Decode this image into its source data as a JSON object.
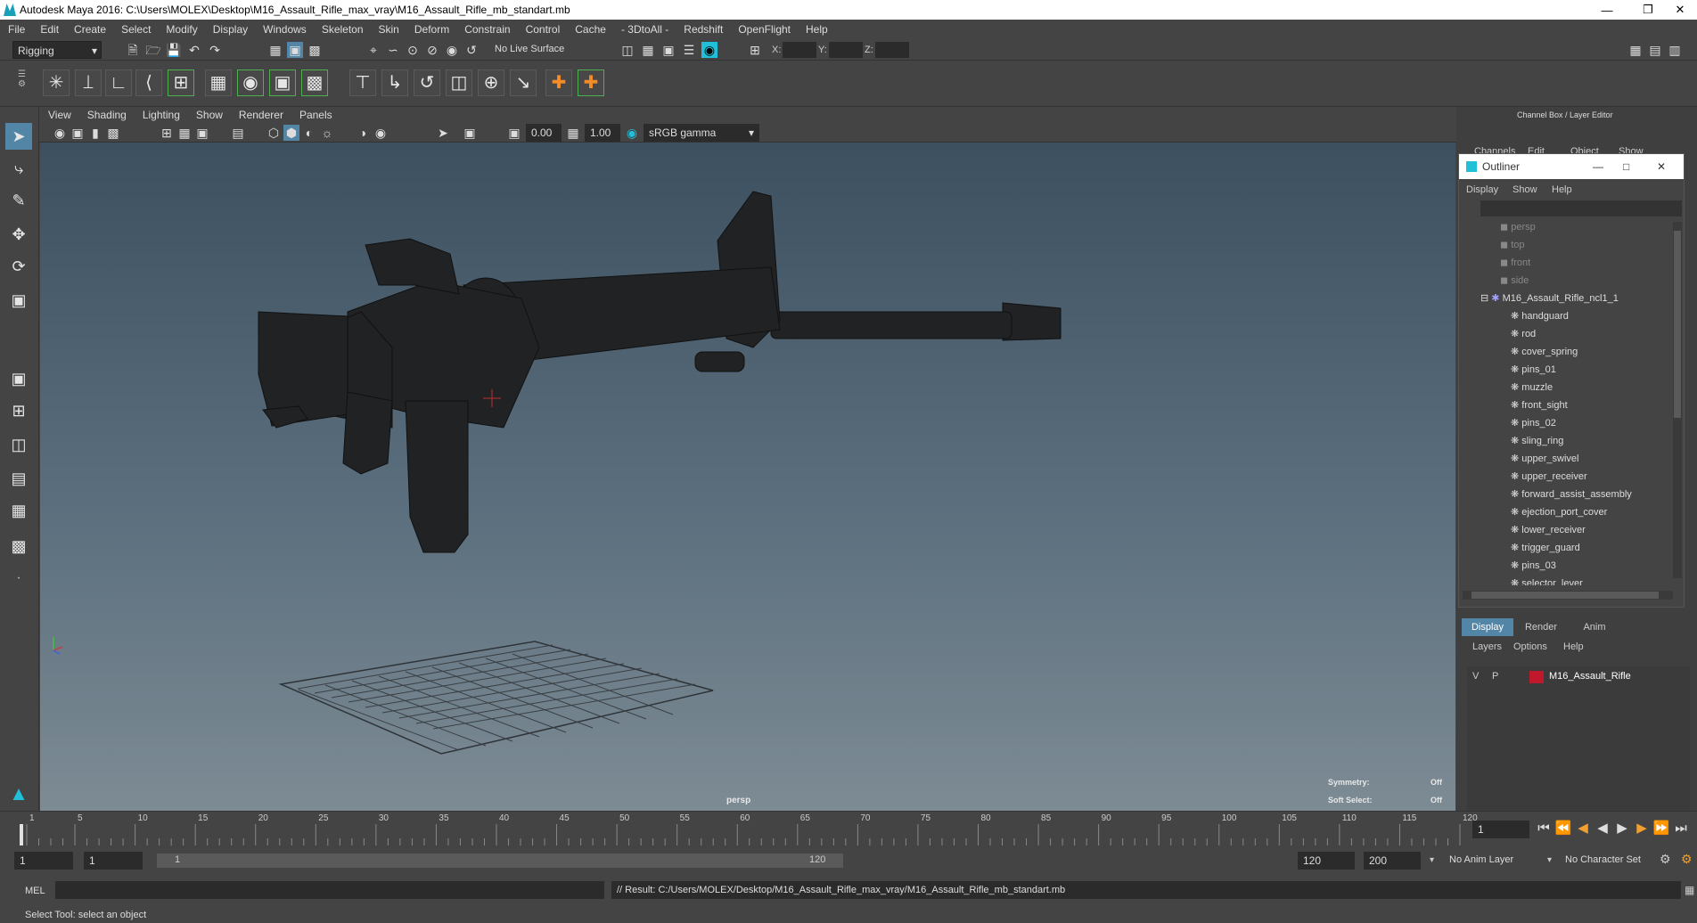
{
  "title": "Autodesk Maya 2016: C:\\Users\\MOLEX\\Desktop\\M16_Assault_Rifle_max_vray\\M16_Assault_Rifle_mb_standart.mb",
  "menu": [
    "File",
    "Edit",
    "Create",
    "Select",
    "Modify",
    "Display",
    "Windows",
    "Skeleton",
    "Skin",
    "Deform",
    "Constrain",
    "Control",
    "Cache",
    "- 3DtoAll -",
    "Redshift",
    "OpenFlight",
    "Help"
  ],
  "status_line": {
    "mode": "Rigging",
    "live_surface": "No Live Surface",
    "x_label": "X:",
    "y_label": "Y:",
    "z_label": "Z:"
  },
  "viewport_menu": [
    "View",
    "Shading",
    "Lighting",
    "Show",
    "Renderer",
    "Panels"
  ],
  "viewport_toolbar": {
    "val1": "0.00",
    "val2": "1.00",
    "color_space": "sRGB gamma"
  },
  "viewport": {
    "camera_label": "persp",
    "symmetry_label": "Symmetry:",
    "symmetry_value": "Off",
    "soft_select_label": "Soft Select:",
    "soft_select_value": "Off"
  },
  "channel_box": {
    "title": "Channel Box / Layer Editor",
    "menu": [
      "Channels",
      "Edit",
      "Object",
      "Show"
    ]
  },
  "outliner": {
    "title": "Outliner",
    "menu": [
      "Display",
      "Show",
      "Help"
    ],
    "cameras": [
      "persp",
      "top",
      "front",
      "side"
    ],
    "root": "M16_Assault_Rifle_ncl1_1",
    "children": [
      "handguard",
      "rod",
      "cover_spring",
      "pins_01",
      "muzzle",
      "front_sight",
      "pins_02",
      "sling_ring",
      "upper_swivel",
      "upper_receiver",
      "forward_assist_assembly",
      "ejection_port_cover",
      "lower_receiver",
      "trigger_guard",
      "pins_03",
      "selector_lever"
    ]
  },
  "layer_editor": {
    "tabs": [
      "Display",
      "Render",
      "Anim"
    ],
    "menu": [
      "Layers",
      "Options",
      "Help"
    ],
    "layer": {
      "v": "V",
      "p": "P",
      "name": "M16_Assault_Rifle",
      "color": "#c0192c"
    }
  },
  "timeline": {
    "ticks": [
      "1",
      "5",
      "10",
      "15",
      "20",
      "25",
      "30",
      "35",
      "40",
      "45",
      "50",
      "55",
      "60",
      "65",
      "70",
      "75",
      "80",
      "85",
      "90",
      "95",
      "100",
      "105",
      "110",
      "115",
      "120"
    ],
    "current_frame": "1"
  },
  "range": {
    "start": "1",
    "playback_start": "1",
    "slider_start": "1",
    "slider_end": "120",
    "end": "120",
    "anim_end": "200",
    "anim_layer": "No Anim Layer",
    "char_set": "No Character Set"
  },
  "command": {
    "lang": "MEL",
    "result": "// Result: C:/Users/MOLEX/Desktop/M16_Assault_Rifle_max_vray/M16_Assault_Rifle_mb_standart.mb"
  },
  "help_line": "Select Tool: select an object",
  "colors": {
    "accent": "#20c0d8",
    "viewport_top": "#3d5060",
    "viewport_bottom": "#7d8b94"
  }
}
